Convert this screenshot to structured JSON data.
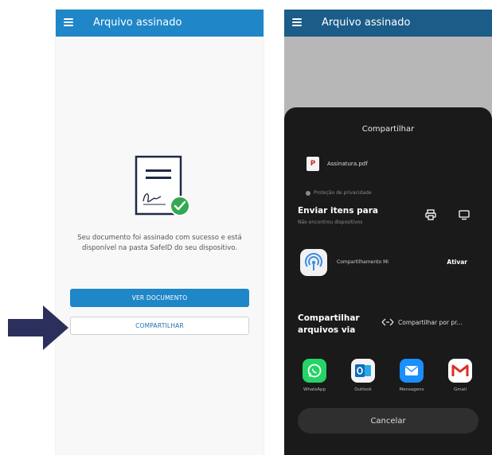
{
  "left": {
    "appbar_title": "Arquivo assinado",
    "message": "Seu documento foi assinado com sucesso e está disponível na pasta SafeID do seu dispositivo.",
    "view_button": "VER DOCUMENTO",
    "share_button": "COMPARTILHAR"
  },
  "right": {
    "appbar_title": "Arquivo assinado",
    "sheet_title": "Compartilhar",
    "file_name": "Assinatura.pdf",
    "privacy": "Proteção de privacidade",
    "send_title": "Enviar itens para",
    "send_subtitle": "Não encontrou dispositivos",
    "mi_label": "Compartilhamento Mi",
    "mi_action": "Ativar",
    "share_title_line1": "Compartilhar",
    "share_title_line2": "arquivos via",
    "nearby_label": "Compartilhar por pr...",
    "apps": [
      {
        "label": "WhatsApp",
        "icon": "whatsapp-icon",
        "color": "#25d366"
      },
      {
        "label": "Outlook",
        "icon": "outlook-icon",
        "color": "#0f6cbd"
      },
      {
        "label": "Mensagens",
        "icon": "messages-icon",
        "color": "#1a8fff"
      },
      {
        "label": "Gmail",
        "icon": "gmail-icon",
        "color": "#ffffff"
      }
    ],
    "cancel": "Cancelar"
  },
  "colors": {
    "primary": "#1f86c7",
    "appbar_dimmed": "#1b5c88",
    "check_green": "#34a853",
    "arrow": "#2b2f5c"
  }
}
